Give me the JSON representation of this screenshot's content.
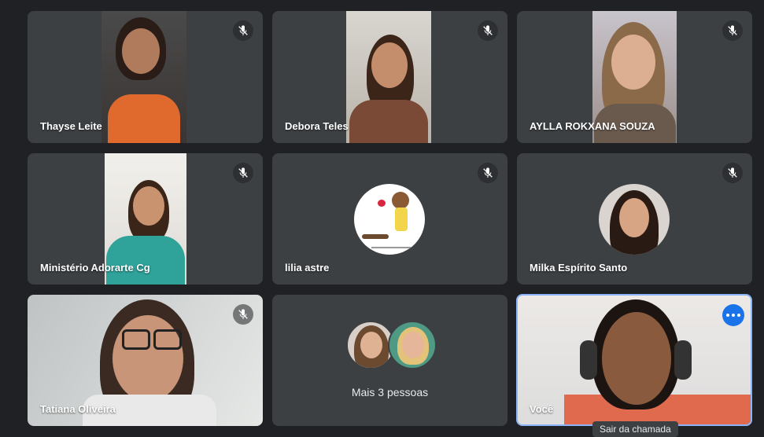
{
  "participants": [
    {
      "name": "Thayse Leite"
    },
    {
      "name": "Debora Teles"
    },
    {
      "name": "AYLLA ROKXANA SOUZA"
    },
    {
      "name": "Ministério Adorarte Cg"
    },
    {
      "name": "lilia astre"
    },
    {
      "name": "Milka Espírito Santo"
    },
    {
      "name": "Tatiana Oliveira"
    },
    {
      "name": "Você"
    }
  ],
  "overflow": {
    "label": "Mais 3 pessoas"
  },
  "tooltip": {
    "leave": "Sair da chamada"
  },
  "colors": {
    "background": "#202124",
    "tile": "#3c4043",
    "self_border": "#8ab4f8",
    "accent": "#1a73e8"
  },
  "icons": {
    "mute": "mic-off-icon",
    "options": "more-options-icon"
  }
}
